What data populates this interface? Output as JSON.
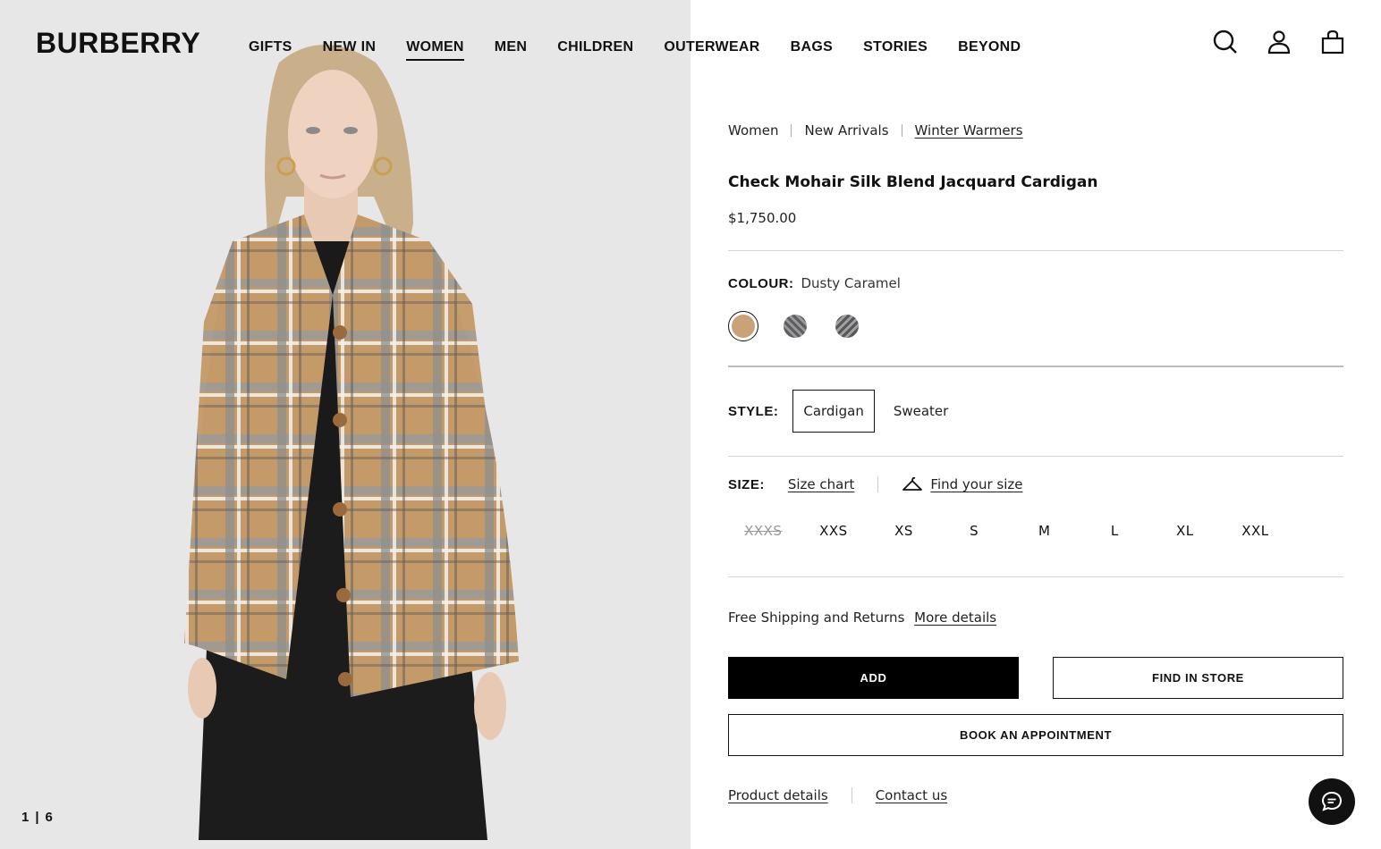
{
  "header": {
    "logo": "BURBERRY",
    "nav": [
      {
        "label": "GIFTS",
        "active": false
      },
      {
        "label": "NEW IN",
        "active": false
      },
      {
        "label": "WOMEN",
        "active": true
      },
      {
        "label": "MEN",
        "active": false
      },
      {
        "label": "CHILDREN",
        "active": false
      },
      {
        "label": "OUTERWEAR",
        "active": false
      },
      {
        "label": "BAGS",
        "active": false
      },
      {
        "label": "STORIES",
        "active": false
      },
      {
        "label": "BEYOND",
        "active": false
      }
    ],
    "icons": [
      "search-icon",
      "account-icon",
      "bag-icon"
    ]
  },
  "gallery": {
    "current": "1",
    "total": "6"
  },
  "breadcrumb": [
    "Women",
    "New Arrivals",
    "Winter Warmers"
  ],
  "product": {
    "title": "Check Mohair Silk Blend Jacquard Cardigan",
    "price": "$1,750.00"
  },
  "colour": {
    "label": "COLOUR:",
    "value": "Dusty Caramel",
    "swatches": [
      {
        "name": "Dusty Caramel",
        "color": "#c9a27a",
        "selected": true
      },
      {
        "name": "grey-check",
        "color": "#6e6e70",
        "selected": false
      },
      {
        "name": "charcoal-check",
        "color": "#6a6a6c",
        "selected": false
      }
    ]
  },
  "style": {
    "label": "STYLE:",
    "options": [
      {
        "label": "Cardigan",
        "selected": true
      },
      {
        "label": "Sweater",
        "selected": false
      }
    ]
  },
  "size": {
    "label": "SIZE:",
    "size_chart": "Size chart",
    "find_size": "Find your size",
    "options": [
      {
        "label": "XXXS",
        "available": false
      },
      {
        "label": "XXS",
        "available": true
      },
      {
        "label": "XS",
        "available": true
      },
      {
        "label": "S",
        "available": true
      },
      {
        "label": "M",
        "available": true
      },
      {
        "label": "L",
        "available": true
      },
      {
        "label": "XL",
        "available": true
      },
      {
        "label": "XXL",
        "available": true
      }
    ]
  },
  "shipping": {
    "text": "Free Shipping and Returns",
    "link": "More details"
  },
  "buttons": {
    "add": "ADD",
    "find_in_store": "FIND IN STORE",
    "book": "BOOK AN APPOINTMENT"
  },
  "footer_links": {
    "details": "Product details",
    "contact": "Contact us"
  },
  "colors": {
    "accent": "#000000",
    "image_bg": "#e7e7e7"
  }
}
